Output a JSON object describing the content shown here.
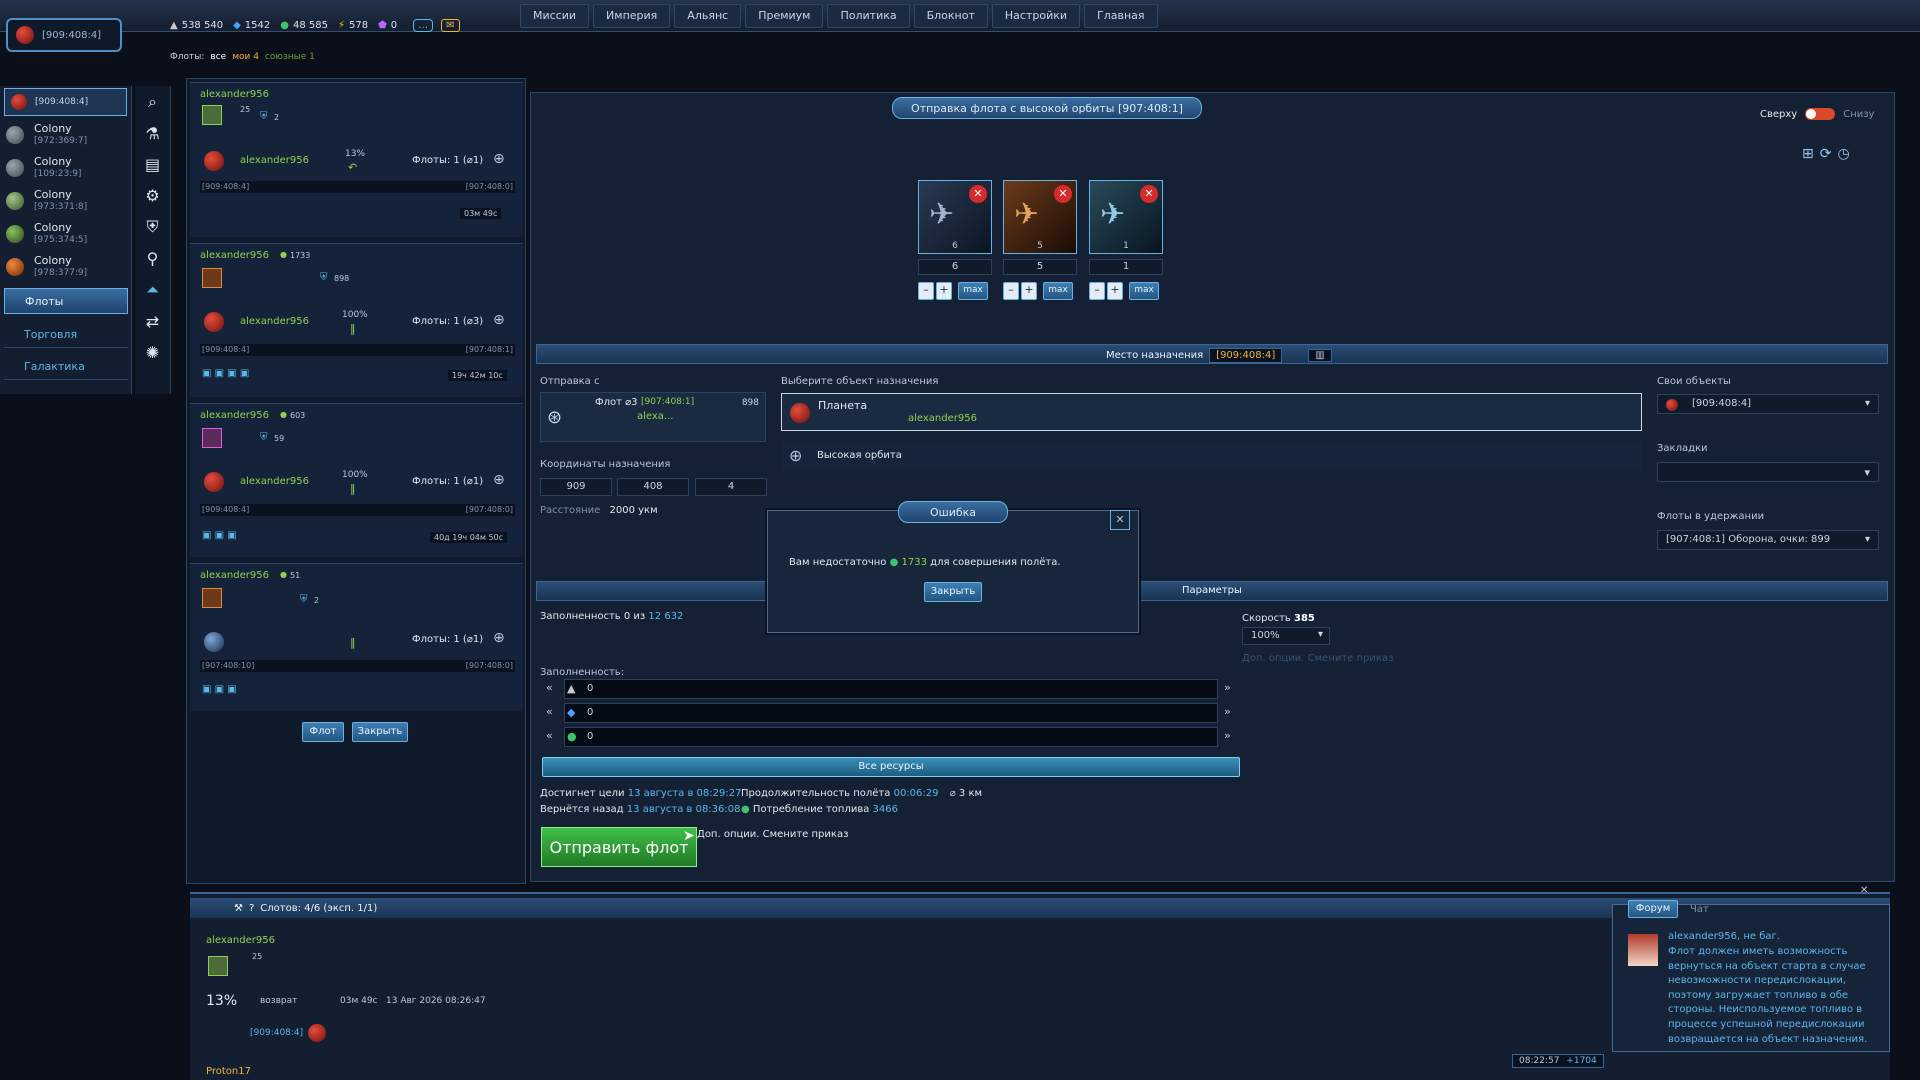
{
  "top": {
    "planet_coords": "[909:408:4]",
    "resources": [
      {
        "icon": "metal-icon",
        "value": "538 540"
      },
      {
        "icon": "crystal-icon",
        "value": "1542"
      },
      {
        "icon": "deuterium-icon",
        "value": "48 585"
      },
      {
        "icon": "energy-icon",
        "value": "578"
      },
      {
        "icon": "gem-icon",
        "value": "0"
      }
    ],
    "menu": [
      "Миссии",
      "Империя",
      "Альянс",
      "Премиум",
      "Политика",
      "Блокнот",
      "Настройки",
      "Главная"
    ],
    "fleet_filter": {
      "label": "Флоты:",
      "all": "все",
      "mine": "мои 4",
      "allied": "союзные 1"
    }
  },
  "left_nav": {
    "current": "[909:408:4]",
    "colonies": [
      {
        "name": "Colony",
        "coords": "[972:369:7]"
      },
      {
        "name": "Colony",
        "coords": "[109:23:9]"
      },
      {
        "name": "Colony",
        "coords": "[973:371:8]"
      },
      {
        "name": "Colony",
        "coords": "[975:374:5]"
      },
      {
        "name": "Colony",
        "coords": "[978:377:9]"
      }
    ],
    "tabs": [
      "Флоты",
      "Торговля",
      "Галактика"
    ]
  },
  "fleets_panel": {
    "cards": [
      {
        "owner": "alexander956",
        "count1": "25",
        "shield": "2",
        "target_owner": "alexander956",
        "pct": "13%",
        "fleets": "Флоты: 1 (⌀1)",
        "from": "[909:408:4]",
        "to": "[907:408:0]",
        "time": "03м 49с"
      },
      {
        "owner": "alexander956",
        "fuel": "1733",
        "shield": "898",
        "target_owner": "alexander956",
        "pct": "100%",
        "fleets": "Флоты: 1 (⌀3)",
        "from": "[909:408:4]",
        "to": "[907:408:1]",
        "time": "19ч 42м 10с"
      },
      {
        "owner": "alexander956",
        "fuel": "603",
        "shield": "59",
        "target_owner": "alexander956",
        "pct": "100%",
        "fleets": "Флоты: 1 (⌀1)",
        "from": "[909:408:4]",
        "to": "[907:408:0]",
        "time": "40д 19ч 04м 50с"
      },
      {
        "owner": "alexander956",
        "fuel": "51",
        "shield": "2",
        "target_owner": "",
        "pct": "",
        "fleets": "Флоты: 1 (⌀1)",
        "from": "[907:408:10]",
        "to": "[907:408:0]",
        "time": ""
      }
    ],
    "btn_fleet": "Флот",
    "btn_close": "Закрыть"
  },
  "main": {
    "title": "Отправка флота с высокой орбиты [907:408:1]",
    "toggle_top": "Сверху",
    "toggle_bottom": "Снизу",
    "ships": [
      {
        "count": "6",
        "qty": "6"
      },
      {
        "count": "5",
        "qty": "5"
      },
      {
        "count": "1",
        "qty": "1"
      }
    ],
    "max": "max",
    "dest_label": "Место назначения",
    "dest_value": "[909:408:4]",
    "from_label": "Отправка с",
    "fleet_name": "Флот ⌀3",
    "fleet_coords": "[907:408:1]",
    "fleet_count": "898",
    "fleet_owner": "alexa...",
    "choose_label": "Выберите объект назначения",
    "planet_label": "Планета",
    "planet_owner": "alexander956",
    "high_orbit": "Высокая орбита",
    "coords_label": "Координаты назначения",
    "coords": [
      "909",
      "408",
      "4"
    ],
    "distance_label": "Расстояние",
    "distance": "2000 укм",
    "own_label": "Свои объекты",
    "own_value": "[909:408:4]",
    "bookmarks_label": "Закладки",
    "hold_label": "Флоты в удержании",
    "hold_value": "[907:408:1] Оборона, очки: 899",
    "params": "Параметры",
    "load_text": "Заполненность 0 из",
    "load_cap": "12 632",
    "speed_label": "Скорость",
    "speed_value": "385",
    "speed_pct": "100%",
    "extra_opts": "Доп. опции. Смените приказ",
    "fill_label": "Заполненность:",
    "res_values": [
      "0",
      "0",
      "0"
    ],
    "all_res": "Все ресурсы",
    "arrive_label": "Достигнет цели",
    "arrive_value": "13 августа в 08:29:27",
    "dur_label": "Продолжительность полёта",
    "dur_value": "00:06:29",
    "dist_short": "3 км",
    "return_label": "Вернётся назад",
    "return_value": "13 августа в 08:36:08",
    "fuel_label": "Потребление топлива",
    "fuel_value": "3466",
    "send_btn": "Отправить флот",
    "extra_opts2": "Доп. опции. Смените приказ"
  },
  "dialog": {
    "title": "Ошибка",
    "msg1": "Вам недостаточно",
    "amount": "1733",
    "msg2": "для совершения полёта.",
    "close": "Закрыть"
  },
  "bottom": {
    "slots": "Слотов: 4/6 (эксп. 1/1)",
    "owner": "alexander956",
    "count": "25",
    "pct": "13%",
    "status": "возврат",
    "time": "03м 49с",
    "date": "13 Авг 2026 08:26:47",
    "coords": "[909:408:4]",
    "footer_user": "Proton17"
  },
  "chat": {
    "tab_forum": "Форум",
    "tab_chat": "Чат",
    "author": "alexander956, не баг.",
    "text": "Флот должен иметь возможность вернуться на объект старта в случае невозможности передислокации, поэтому загружает топливо в обе стороны. Неиспользуемое топливо в процессе успешной передислокации возвращается на объект назначения.",
    "clock": "08:22:57",
    "tz": "+1704"
  }
}
